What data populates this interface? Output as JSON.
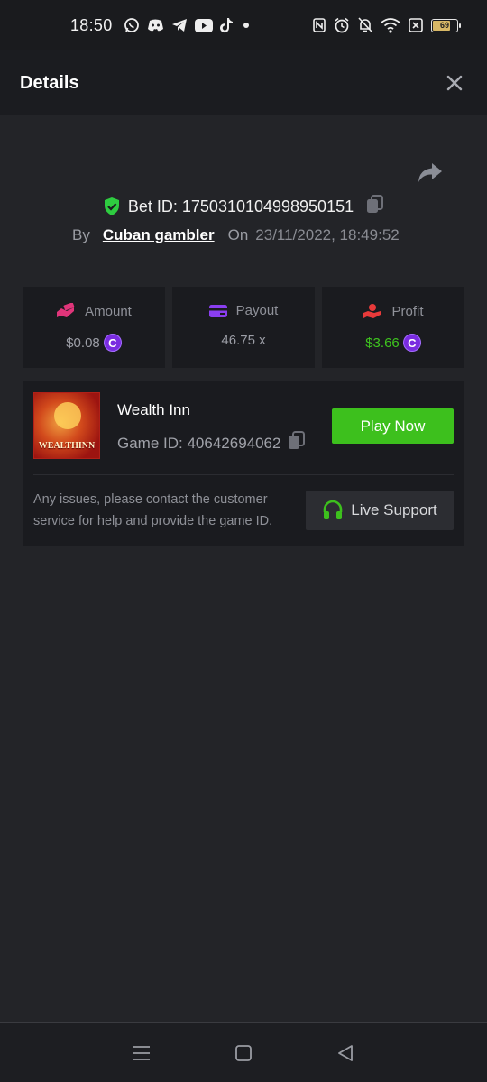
{
  "status_bar": {
    "time": "18:50",
    "battery": "69",
    "notification_icons": [
      "whatsapp-icon",
      "discord-icon",
      "telegram-icon",
      "youtube-icon",
      "tiktok-icon",
      "dot-icon"
    ],
    "system_icons": [
      "nfc-icon",
      "alarm-icon",
      "bell-off-icon",
      "wifi-icon",
      "sim-off-icon",
      "battery-icon"
    ]
  },
  "header": {
    "title": "Details",
    "close_icon": "close-icon"
  },
  "bet": {
    "bet_id_label": "Bet ID: 1750310104998950151",
    "by_label": "By",
    "username": "Cuban gambler",
    "on_label": "On",
    "datetime": "23/11/2022, 18:49:52"
  },
  "stats": [
    {
      "label": "Amount",
      "value": "$0.08",
      "icon": "money-hand-icon",
      "icon_color": "#e0357a",
      "value_color": "#9c9ea6",
      "coin": true
    },
    {
      "label": "Payout",
      "value": "46.75 x",
      "icon": "card-icon",
      "icon_color": "#8a3ef0",
      "value_color": "#9c9ea6",
      "coin": false
    },
    {
      "label": "Profit",
      "value": "$3.66",
      "icon": "hand-coin-icon",
      "icon_color": "#e83a3a",
      "value_color": "#3ec41f",
      "coin": true
    }
  ],
  "coin_symbol": "C",
  "game": {
    "thumbnail_text": "WEALTHINN",
    "name": "Wealth Inn",
    "game_id_label": "Game ID: 40642694062",
    "play_label": "Play Now",
    "help_text": "Any issues, please contact the customer service for help and provide the game ID.",
    "support_label": "Live Support"
  },
  "colors": {
    "accent_green": "#3dc01d",
    "shield_green": "#2ecc40",
    "coin_purple": "#7a2ce0",
    "background": "#232428"
  },
  "nav_bar": [
    "menu-icon",
    "home-square-icon",
    "back-triangle-icon"
  ]
}
